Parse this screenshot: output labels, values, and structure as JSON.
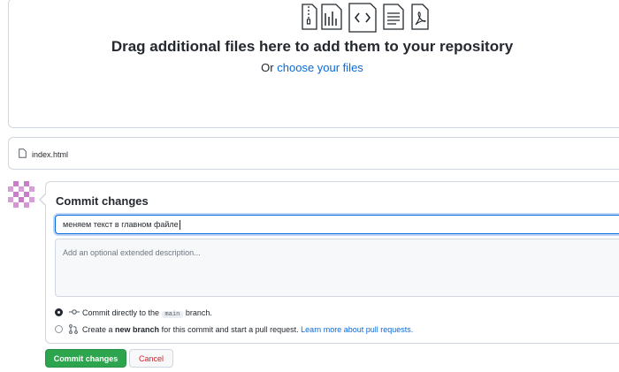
{
  "dropzone": {
    "title": "Drag additional files here to add them to your repository",
    "or_text": "Or",
    "choose_link": "choose your files",
    "icons": [
      "file-zip-icon",
      "file-chart-icon",
      "file-code-icon",
      "file-text-icon",
      "file-pdf-icon"
    ]
  },
  "file": {
    "name": "index.html"
  },
  "commit": {
    "title": "Commit changes",
    "summary_value": "меняем текст в главном файле",
    "description_placeholder": "Add an optional extended description...",
    "option_direct": {
      "prefix": "Commit directly to the",
      "branch": "main",
      "suffix": "branch.",
      "selected": true
    },
    "option_new_branch": {
      "prefix": "Create a",
      "bold": "new branch",
      "middle": "for this commit and start a pull request.",
      "link": "Learn more about pull requests.",
      "selected": false
    }
  },
  "buttons": {
    "commit": "Commit changes",
    "cancel": "Cancel"
  },
  "colors": {
    "accent": "#0969da",
    "commit_button": "#2da44e",
    "cancel_text": "#cf222e",
    "avatar": "#c97dc9"
  }
}
